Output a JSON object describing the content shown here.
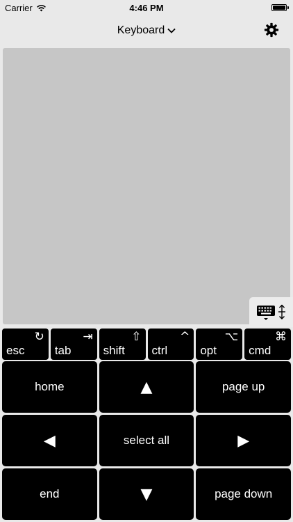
{
  "status_bar": {
    "carrier": "Carrier",
    "time": "4:46 PM"
  },
  "nav": {
    "title": "Keyboard",
    "title_icon": "chevron-down-icon",
    "settings_icon": "gear-icon"
  },
  "modifiers": [
    {
      "label": "esc",
      "glyph": "↻",
      "icon": "refresh-icon"
    },
    {
      "label": "tab",
      "glyph": "⇥",
      "icon": "tab-icon"
    },
    {
      "label": "shift",
      "glyph": "⇧",
      "icon": "shift-icon"
    },
    {
      "label": "ctrl",
      "glyph": "^",
      "icon": "control-icon"
    },
    {
      "label": "opt",
      "glyph": "⌥",
      "icon": "option-icon"
    },
    {
      "label": "cmd",
      "glyph": "⌘",
      "icon": "command-icon"
    }
  ],
  "keypad": {
    "home": "home",
    "up": "▲",
    "page_up": "page up",
    "left": "◀",
    "select_all": "select all",
    "right": "▶",
    "end": "end",
    "down": "▼",
    "page_down": "page down"
  },
  "colors": {
    "key_bg": "#000000",
    "key_text": "#ffffff",
    "trackpad": "#c6c6c6",
    "background": "#e9e9e9"
  }
}
